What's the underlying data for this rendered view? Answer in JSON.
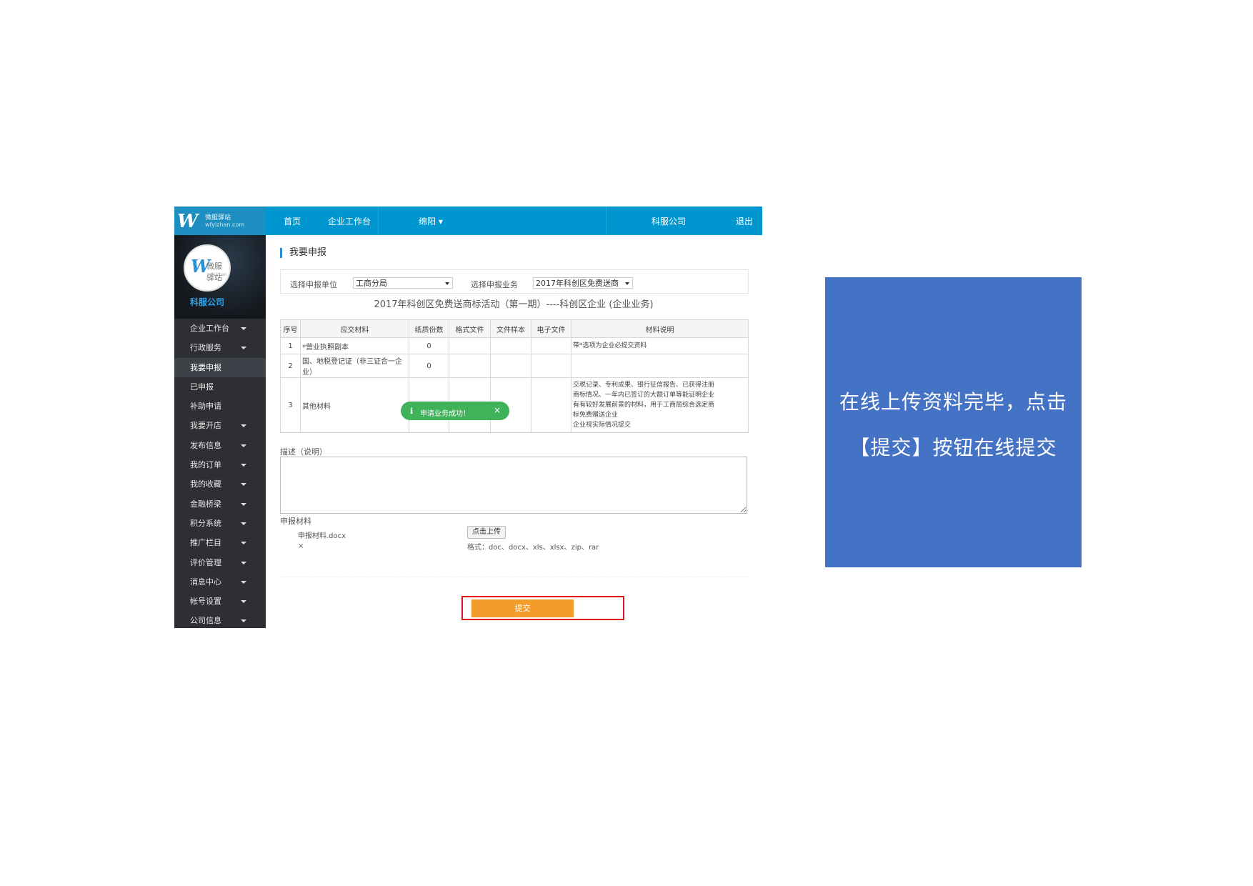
{
  "topbar": {
    "brand_name": "微服驿站",
    "brand_url": "wfyizhan.com",
    "nav": [
      "首页",
      "企业工作台",
      "绵阳 ▾"
    ],
    "company": "科服公司",
    "logout": "退出"
  },
  "sidebar": {
    "avatar_text": "微服驿站",
    "avatar_small": "wfyizhan",
    "company": "科服公司",
    "items": [
      {
        "label": "企业工作台",
        "caret": true
      },
      {
        "label": "行政服务",
        "caret": true
      },
      {
        "label": "我要申报",
        "caret": false,
        "active": true
      },
      {
        "label": "已申报",
        "caret": false
      },
      {
        "label": "补助申请",
        "caret": false
      },
      {
        "label": "我要开店",
        "caret": true
      },
      {
        "label": "发布信息",
        "caret": true
      },
      {
        "label": "我的订单",
        "caret": true
      },
      {
        "label": "我的收藏",
        "caret": true
      },
      {
        "label": "金融桥梁",
        "caret": true
      },
      {
        "label": "积分系统",
        "caret": true
      },
      {
        "label": "推广栏目",
        "caret": true
      },
      {
        "label": "评价管理",
        "caret": true
      },
      {
        "label": "消息中心",
        "caret": true
      },
      {
        "label": "帐号设置",
        "caret": true
      },
      {
        "label": "公司信息",
        "caret": true
      }
    ]
  },
  "main": {
    "title": "我要申报",
    "unit_label": "选择申报单位",
    "unit_value": "工商分局",
    "business_label": "选择申报业务",
    "business_value": "2017年科创区免费送商",
    "activity_title": "2017年科创区免费送商标活动（第一期）----科创区企业 (企业业务)",
    "table": {
      "headers": [
        "序号",
        "应交材料",
        "纸质份数",
        "格式文件",
        "文件样本",
        "电子文件",
        "材料说明"
      ],
      "rows": [
        {
          "no": "1",
          "material": "*营业执照副本",
          "copies": "0",
          "note": [
            "带*选项为企业必提交资料"
          ]
        },
        {
          "no": "2",
          "material": "国、地税登记证（非三证合一企业）",
          "copies": "0",
          "note": []
        },
        {
          "no": "3",
          "material": "其他材料",
          "copies": "",
          "note": [
            "交税记录、专利成果、银行征信报告、已获得注册",
            "商标情况、一年内已签订的大额订单等能证明企业",
            "有有较好发展前景的材料，用于工商局综合选定商",
            "标免费赠送企业",
            "企业视实际情况提交"
          ]
        }
      ]
    },
    "toast": {
      "icon": "ℹ",
      "text": "申请业务成功！",
      "close": "×"
    },
    "desc_label": "描述（说明）",
    "files_label": "申报材料",
    "file_name": "申报材料.docx",
    "file_remove": "×",
    "upload_label": "点击上传",
    "formats": "格式：doc、docx、xls、xlsx、zip、rar",
    "submit_label": "提交"
  },
  "callout": {
    "line1": "在线上传资料完毕，点击",
    "line2": "【提交】按钮在线提交"
  },
  "colors": {
    "topbar": "#0097d0",
    "sidebar": "#2d2f33",
    "submit": "#f39c2b",
    "highlight": "#e0151b",
    "toast": "#3fb25a",
    "callout": "#4472c4"
  }
}
